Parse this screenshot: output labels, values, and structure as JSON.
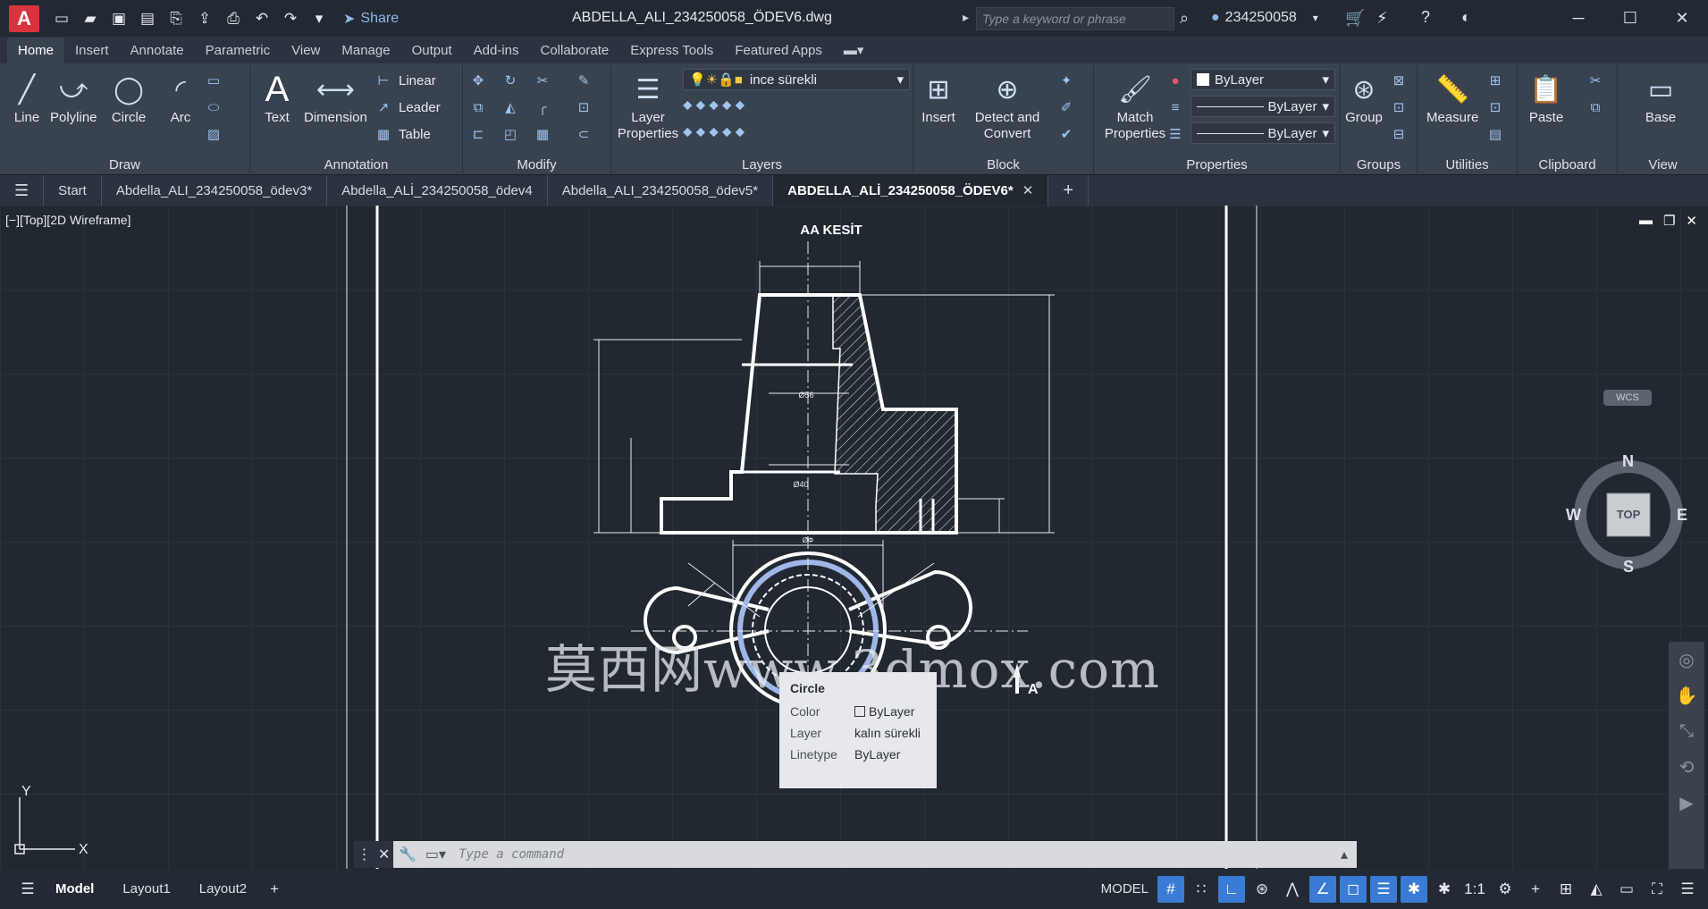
{
  "app": {
    "logo": "A",
    "title": "ABDELLA_ALI_234250058_ÖDEV6.dwg",
    "share": "Share",
    "search_placeholder": "Type a keyword or phrase",
    "user": "234250058"
  },
  "ribbon_tabs": [
    "Home",
    "Insert",
    "Annotate",
    "Parametric",
    "View",
    "Manage",
    "Output",
    "Add-ins",
    "Collaborate",
    "Express Tools",
    "Featured Apps"
  ],
  "panels": {
    "draw": {
      "title": "Draw",
      "line": "Line",
      "polyline": "Polyline",
      "circle": "Circle",
      "arc": "Arc"
    },
    "annotation": {
      "title": "Annotation",
      "text": "Text",
      "dimension": "Dimension",
      "linear": "Linear",
      "leader": "Leader",
      "table": "Table"
    },
    "modify": {
      "title": "Modify"
    },
    "layers": {
      "title": "Layers",
      "layer_properties": "Layer Properties",
      "current_layer": "ince sürekli"
    },
    "block": {
      "title": "Block",
      "insert": "Insert",
      "detect": "Detect and Convert"
    },
    "properties": {
      "title": "Properties",
      "match": "Match Properties",
      "color": "ByLayer",
      "lineweight": "ByLayer",
      "linetype": "ByLayer"
    },
    "groups": {
      "title": "Groups",
      "group": "Group"
    },
    "utilities": {
      "title": "Utilities",
      "measure": "Measure"
    },
    "clipboard": {
      "title": "Clipboard",
      "paste": "Paste"
    },
    "view": {
      "title": "View",
      "base": "Base"
    }
  },
  "doc_tabs": [
    {
      "label": "Start"
    },
    {
      "label": "Abdella_ALI_234250058_ödev3*"
    },
    {
      "label": "Abdella_ALİ_234250058_ödev4"
    },
    {
      "label": "Abdella_ALI_234250058_ödev5*"
    },
    {
      "label": "ABDELLA_ALİ_234250058_ÖDEV6*"
    }
  ],
  "viewport": {
    "label": "[−][Top][2D Wireframe]",
    "section_title": "AA KESİT",
    "dim_1": "Ø56",
    "dim_2": "Ø40",
    "dim_3": "ØΦ",
    "section_marker": "A"
  },
  "watermark": "莫西网www.3dmox.com",
  "tooltip": {
    "title": "Circle",
    "rows": [
      {
        "k": "Color",
        "v": "ByLayer"
      },
      {
        "k": "Layer",
        "v": "kalın sürekli"
      },
      {
        "k": "Linetype",
        "v": "ByLayer"
      }
    ]
  },
  "navcube": {
    "n": "N",
    "s": "S",
    "e": "E",
    "w": "W",
    "top": "TOP",
    "wcs": "WCS"
  },
  "ucs": {
    "y": "Y",
    "x": "X"
  },
  "command": {
    "placeholder": "Type a command"
  },
  "status": {
    "tabs": [
      "Model",
      "Layout1",
      "Layout2"
    ],
    "model": "MODEL",
    "scale": "1:1"
  },
  "colors": {
    "accent": "#3a7bd5",
    "canvas": "#212830",
    "ribbon": "#39424f",
    "logo": "#d9343e"
  }
}
